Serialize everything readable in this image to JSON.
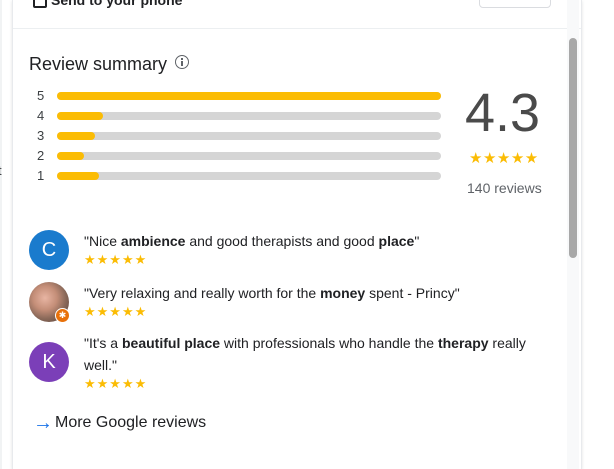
{
  "left_edge": {
    "text": "t"
  },
  "top_strip": {
    "send_label": "Send to your phone",
    "button_label": ""
  },
  "summary": {
    "title": "Review summary",
    "rating": "4.3",
    "stars": "★★★★★",
    "count": "140 reviews",
    "bars": [
      {
        "label": "5",
        "fraction": 1.0
      },
      {
        "label": "4",
        "fraction": 0.12
      },
      {
        "label": "3",
        "fraction": 0.1
      },
      {
        "label": "2",
        "fraction": 0.07
      },
      {
        "label": "1",
        "fraction": 0.11
      }
    ]
  },
  "snippets": [
    {
      "avatar": "C",
      "avatar_type": "letter-blue",
      "parts": [
        [
          "\"Nice ",
          false
        ],
        [
          "ambience",
          true
        ],
        [
          " and good therapists and good ",
          false
        ],
        [
          "place",
          true
        ],
        [
          "\"",
          false
        ]
      ],
      "stars": "★★★★★"
    },
    {
      "avatar": "",
      "avatar_type": "photo",
      "badge": "✱",
      "parts": [
        [
          "\"Very relaxing and really worth for the ",
          false
        ],
        [
          "money",
          true
        ],
        [
          " spent - Princy\"",
          false
        ]
      ],
      "stars": "★★★★★"
    },
    {
      "avatar": "K",
      "avatar_type": "letter-purple",
      "parts": [
        [
          "\"It's a ",
          false
        ],
        [
          "beautiful place",
          true
        ],
        [
          " with professionals who handle the ",
          false
        ],
        [
          "therapy",
          true
        ],
        [
          " really well.\"",
          false
        ]
      ],
      "stars": "★★★★★"
    }
  ],
  "more_reviews": {
    "label": "More Google reviews",
    "icon": "arrow-right-icon"
  },
  "colors": {
    "accent_yellow": "#fbbc04",
    "link_blue": "#1a73e8",
    "avatar_c": "#1a7bcd",
    "avatar_k": "#7b3fb8"
  }
}
